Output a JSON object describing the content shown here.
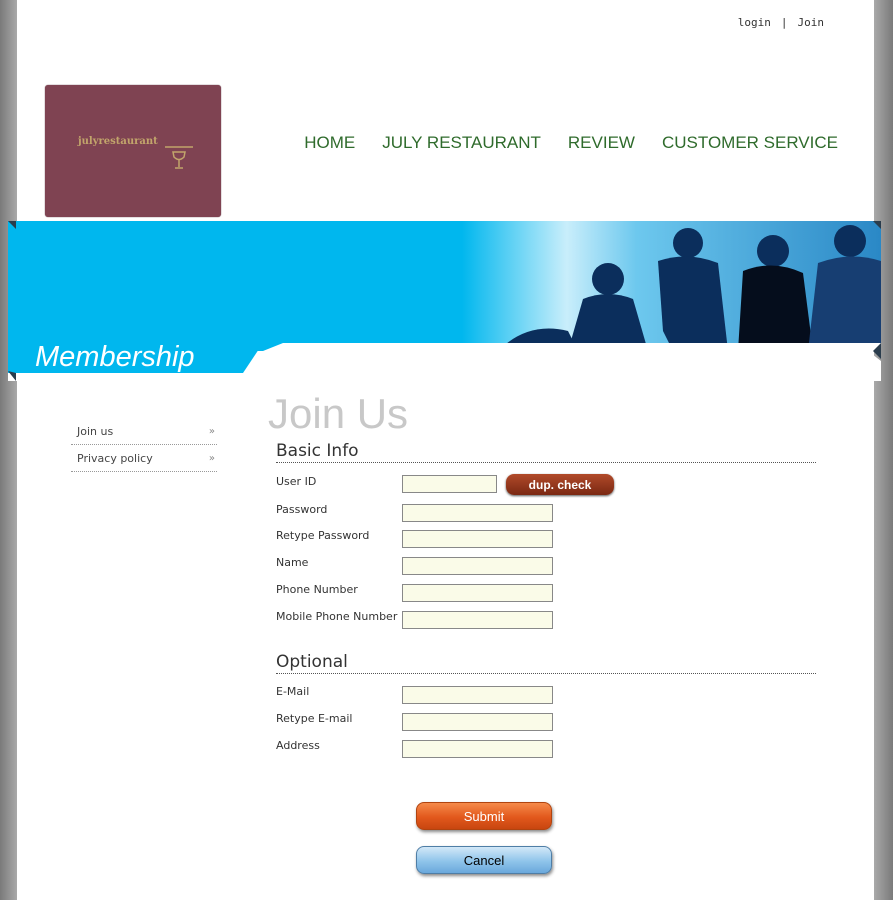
{
  "header": {
    "login": "login",
    "separator": "|",
    "join": "Join",
    "logo_text": "julyrestaurant",
    "nav": [
      "HOME",
      "JULY RESTAURANT",
      "REVIEW",
      "CUSTOMER SERVICE"
    ]
  },
  "banner": {
    "title": "Membership"
  },
  "sidebar": {
    "items": [
      {
        "label": "Join us",
        "arrow": "»"
      },
      {
        "label": "Privacy policy",
        "arrow": "»"
      }
    ]
  },
  "form": {
    "title": "Join Us",
    "basic_title": "Basic Info",
    "optional_title": "Optional",
    "fields": {
      "userid": "User ID",
      "password": "Password",
      "retype_password": "Retype Password",
      "name": "Name",
      "phone": "Phone Number",
      "mobile": "Mobile Phone Number",
      "email": "E-Mail",
      "retype_email": "Retype E-mail",
      "address": "Address"
    },
    "dup_check": "dup. check",
    "submit": "Submit",
    "cancel": "Cancel"
  },
  "colors": {
    "logo_bg": "#7f4352",
    "nav": "#2f6b2c",
    "banner": "#00b7ee"
  }
}
